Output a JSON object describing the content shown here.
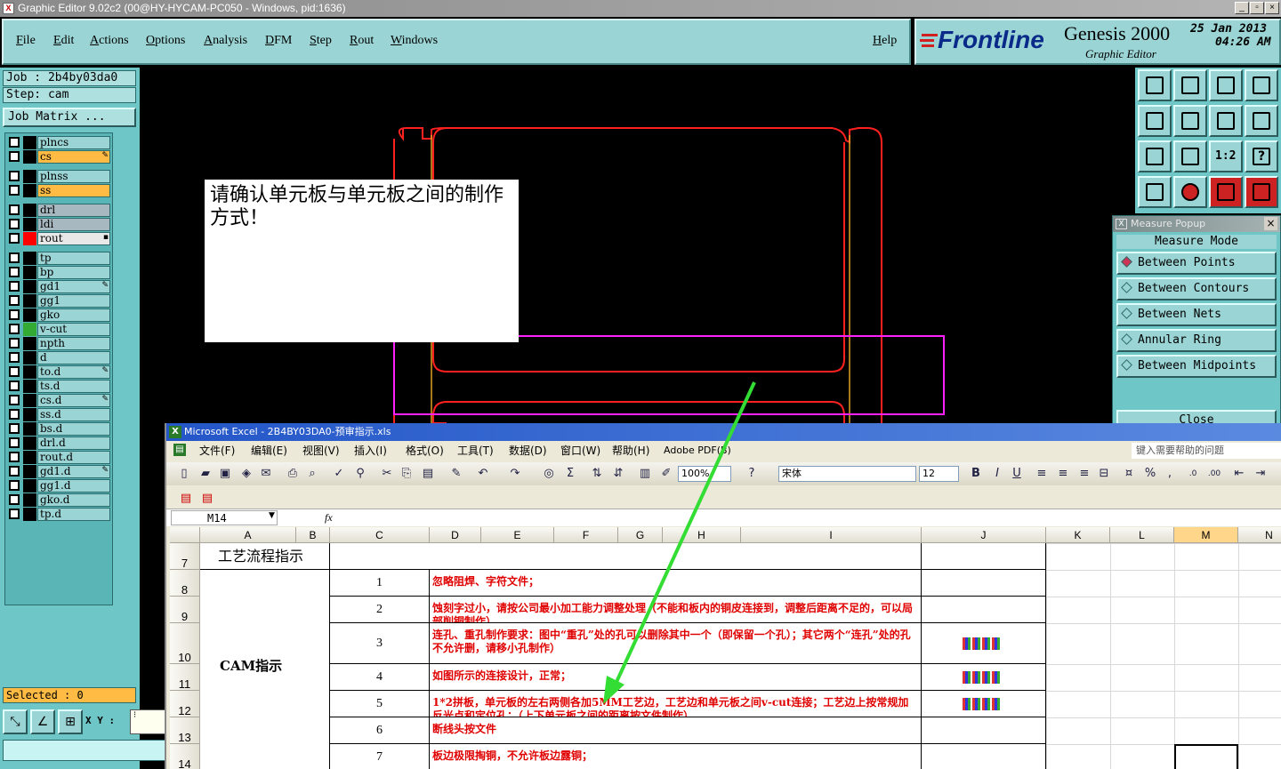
{
  "genesis": {
    "title": "Graphic Editor 9.02c2 (00@HY-HYCAM-PC050 - Windows, pid:1636)",
    "menu": [
      "File",
      "Edit",
      "Actions",
      "Options",
      "Analysis",
      "DFM",
      "Step",
      "Rout",
      "Windows"
    ],
    "help": "Help",
    "brand": "Frontline",
    "product": "Genesis 2000",
    "subtitle": "Graphic Editor",
    "date": "25 Jan 2013",
    "time": "04:26 AM",
    "job": "Job : 2b4by03da0",
    "step": "Step: cam",
    "job_matrix": "Job Matrix ...",
    "layers": [
      {
        "name": "plncs",
        "color": "#000000",
        "style": "normal",
        "mark": ""
      },
      {
        "name": "cs",
        "color": "#000000",
        "style": "board",
        "mark": "✎"
      },
      {
        "name": "plnss",
        "color": "#000000",
        "style": "normal",
        "mark": ""
      },
      {
        "name": "ss",
        "color": "#000000",
        "style": "board",
        "mark": ""
      },
      {
        "name": "drl",
        "color": "#000000",
        "style": "grey",
        "mark": ""
      },
      {
        "name": "ldi",
        "color": "#000000",
        "style": "grey",
        "mark": ""
      },
      {
        "name": "rout",
        "color": "#ff0000",
        "style": "white",
        "mark": "▪"
      },
      {
        "name": "tp",
        "color": "#000000",
        "style": "normal",
        "mark": ""
      },
      {
        "name": "bp",
        "color": "#000000",
        "style": "normal",
        "mark": ""
      },
      {
        "name": "gd1",
        "color": "#000000",
        "style": "normal",
        "mark": "✎"
      },
      {
        "name": "gg1",
        "color": "#000000",
        "style": "normal",
        "mark": ""
      },
      {
        "name": "gko",
        "color": "#000000",
        "style": "normal",
        "mark": ""
      },
      {
        "name": "v-cut",
        "color": "#33aa33",
        "style": "normal",
        "mark": ""
      },
      {
        "name": "npth",
        "color": "#000000",
        "style": "normal",
        "mark": ""
      },
      {
        "name": "d",
        "color": "#000000",
        "style": "normal",
        "mark": ""
      },
      {
        "name": "to.d",
        "color": "#000000",
        "style": "normal",
        "mark": "✎"
      },
      {
        "name": "ts.d",
        "color": "#000000",
        "style": "normal",
        "mark": ""
      },
      {
        "name": "cs.d",
        "color": "#000000",
        "style": "normal",
        "mark": "✎"
      },
      {
        "name": "ss.d",
        "color": "#000000",
        "style": "normal",
        "mark": ""
      },
      {
        "name": "bs.d",
        "color": "#000000",
        "style": "normal",
        "mark": ""
      },
      {
        "name": "drl.d",
        "color": "#000000",
        "style": "normal",
        "mark": ""
      },
      {
        "name": "rout.d",
        "color": "#000000",
        "style": "normal",
        "mark": ""
      },
      {
        "name": "gd1.d",
        "color": "#000000",
        "style": "normal",
        "mark": "✎"
      },
      {
        "name": "gg1.d",
        "color": "#000000",
        "style": "normal",
        "mark": ""
      },
      {
        "name": "gko.d",
        "color": "#000000",
        "style": "normal",
        "mark": ""
      },
      {
        "name": "tp.d",
        "color": "#000000",
        "style": "normal",
        "mark": ""
      }
    ],
    "selected": "Selected : 0",
    "xy_label": "X Y :",
    "canvas_note": "请确认单元板与单元板之间的制作方式！",
    "measure": {
      "title": "Measure Popup",
      "mode_label": "Measure Mode",
      "options": [
        "Between Points",
        "Between Contours",
        "Between Nets",
        "Annular Ring",
        "Between Midpoints"
      ],
      "selected": 0,
      "close": "Close"
    },
    "zoom_ratio_label": "1:2",
    "help_tool_label": "?"
  },
  "excel": {
    "title": "Microsoft Excel - 2B4BY03DA0-预审指示.xls",
    "menu": [
      "文件(F)",
      "编辑(E)",
      "视图(V)",
      "插入(I)",
      "格式(O)",
      "工具(T)",
      "数据(D)",
      "窗口(W)",
      "帮助(H)",
      "Adobe PDF(B)"
    ],
    "help_placeholder": "键入需要帮助的问题",
    "zoom": "100%",
    "font": "宋体",
    "font_size": "12",
    "name_box": "M14",
    "fx": "fx",
    "columns": [
      "A",
      "B",
      "C",
      "D",
      "E",
      "F",
      "G",
      "H",
      "I",
      "J",
      "K",
      "L",
      "M",
      "N"
    ],
    "active_column": "M",
    "rows": [
      "7",
      "8",
      "9",
      "10",
      "11",
      "12",
      "13",
      "14"
    ],
    "section_title": "工艺流程指示",
    "group_label": "CAM指示",
    "items": [
      {
        "num": "1",
        "text": "忽略阻焊、字符文件；",
        "thumb": false
      },
      {
        "num": "2",
        "text": "蚀刻字过小，请按公司最小加工能力调整处理（不能和板内的铜皮连接到，调整后距离不足的，可以局部削铜制作）",
        "thumb": false
      },
      {
        "num": "3",
        "text": "连孔、重孔制作要求：图中“重孔”处的孔可以删除其中一个（即保留一个孔）；其它两个“连孔”处的孔不允许删，请移小孔制作）",
        "thumb": true
      },
      {
        "num": "4",
        "text": "如图所示的连接设计，正常；",
        "thumb": true
      },
      {
        "num": "5",
        "text": "1*2拼板，单元板的左右两侧各加5MM工艺边，工艺边和单元板之间v-cut连接；工艺边上按常规加反光点和定位孔；（上下单元板之间的距离按文件制作）",
        "thumb": true
      },
      {
        "num": "6",
        "text": "断线头按文件",
        "thumb": false
      },
      {
        "num": "7",
        "text": "板边极限掏铜，不允许板边露铜；",
        "thumb": false
      }
    ]
  },
  "colors": {
    "genesis_panel": "#9ad4d4",
    "board": "#ffbb44",
    "outline_red": "#ff2020",
    "outline_magenta": "#ff20ff",
    "arrow_green": "#33dd33",
    "excel_red_text": "#e00000"
  }
}
